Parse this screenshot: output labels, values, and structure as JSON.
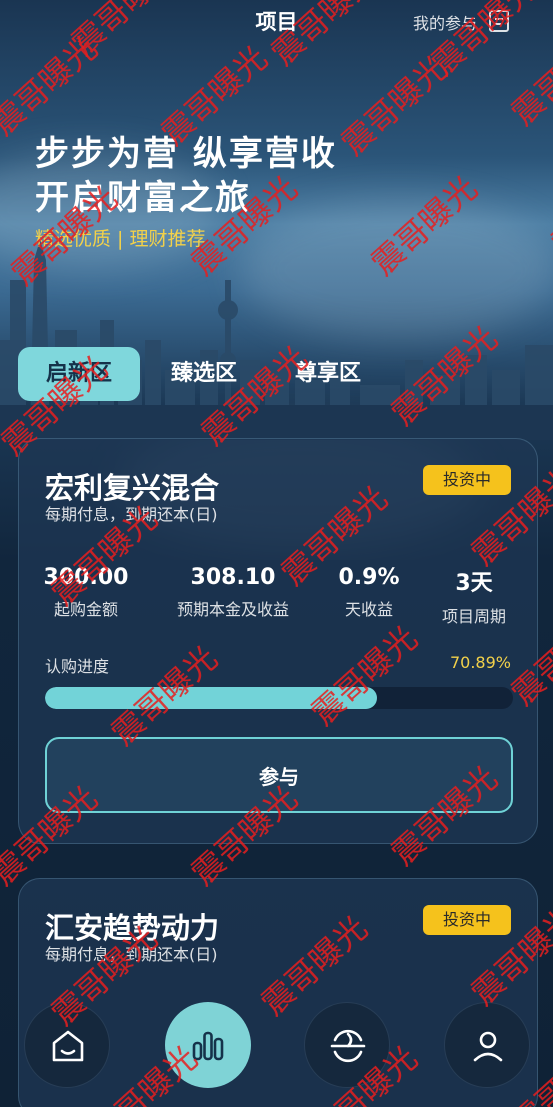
{
  "header": {
    "title": "项目",
    "my_participation": "我的参与",
    "doc_icon": "doc-icon"
  },
  "hero": {
    "line1": "步步为营 纵享营收",
    "line2": "开启财富之旅",
    "subtitle": "精选优质 | 理财推荐"
  },
  "tabs": [
    {
      "label": "启新区",
      "active": true
    },
    {
      "label": "臻选区",
      "active": false
    },
    {
      "label": "尊享区",
      "active": false
    }
  ],
  "products": [
    {
      "name": "宏利复兴混合",
      "repayment": "每期付息，到期还本(日)",
      "status": "投资中",
      "stats": [
        {
          "value": "300.00",
          "label": "起购金额"
        },
        {
          "value": "308.10",
          "label": "预期本金及收益"
        },
        {
          "value": "0.9%",
          "label": "天收益"
        },
        {
          "value": "3天",
          "label": "项目周期"
        }
      ],
      "progress_label": "认购进度",
      "progress_pct_text": "70.89%",
      "progress": 0.7089,
      "button": "参与"
    },
    {
      "name": "汇安趋势动力",
      "repayment": "每期付息，到期还本(日)",
      "status": "投资中"
    }
  ],
  "bottom_nav": [
    {
      "icon": "home-icon",
      "active": false
    },
    {
      "icon": "bar-chart-icon",
      "active": true
    },
    {
      "icon": "discover-icon",
      "active": false
    },
    {
      "icon": "user-icon",
      "active": false
    }
  ],
  "watermark": "震哥曝光",
  "colors": {
    "accent": "#7fd7dc",
    "badge": "#f5c21c",
    "highlight_text": "#f2d14a",
    "watermark": "#e61e1e"
  }
}
